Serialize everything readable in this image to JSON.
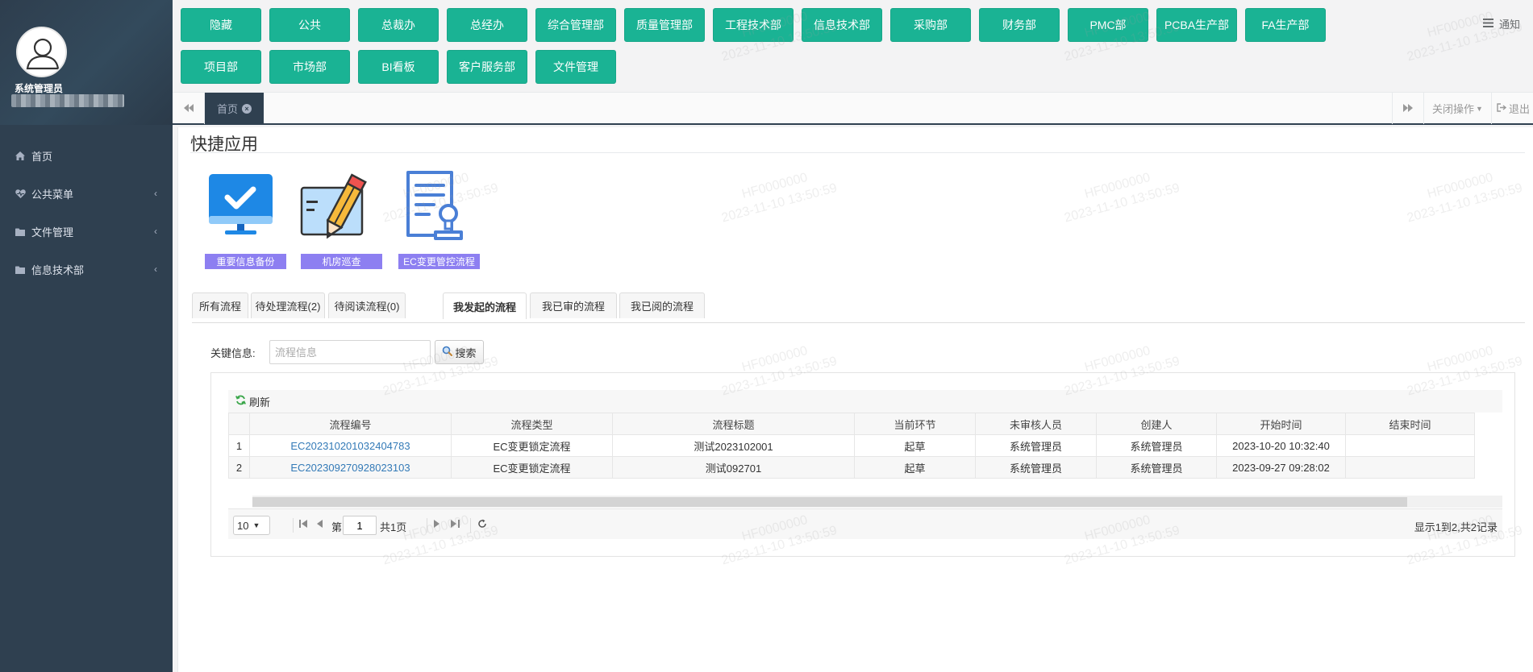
{
  "sidebar": {
    "user_role": "系统管理员",
    "user_name": "",
    "items": [
      {
        "label": "首页",
        "icon": "home-icon"
      },
      {
        "label": "公共菜单",
        "icon": "heartbeat-icon"
      },
      {
        "label": "文件管理",
        "icon": "folder-icon"
      },
      {
        "label": "信息技术部",
        "icon": "folder-icon"
      }
    ]
  },
  "departments": [
    "隐藏",
    "公共",
    "总裁办",
    "总经办",
    "综合管理部",
    "质量管理部",
    "工程技术部",
    "信息技术部",
    "采购部",
    "财务部",
    "PMC部",
    "PCBA生产部",
    "FA生产部",
    "项目部",
    "市场部",
    "BI看板",
    "客户服务部",
    "文件管理"
  ],
  "header": {
    "notice_label": "通知",
    "home_tab": "首页",
    "close_ops": "关闭操作",
    "logout": "退出"
  },
  "quick_apps": {
    "title": "快捷应用",
    "items": [
      {
        "label": "重要信息备份",
        "icon": "monitor-check-icon"
      },
      {
        "label": "机房巡查",
        "icon": "pencil-document-icon"
      },
      {
        "label": "EC变更管控流程",
        "icon": "document-stamp-icon"
      }
    ]
  },
  "flow_tabs": [
    {
      "label": "所有流程"
    },
    {
      "label": "待处理流程(2)"
    },
    {
      "label": "待阅读流程(0)"
    },
    {
      "label": "我发起的流程",
      "active": true
    },
    {
      "label": "我已审的流程"
    },
    {
      "label": "我已阅的流程"
    }
  ],
  "search": {
    "label": "关键信息:",
    "placeholder": "流程信息",
    "value": "",
    "button": "搜索"
  },
  "grid": {
    "refresh": "刷新",
    "columns": [
      "流程编号",
      "流程类型",
      "流程标题",
      "当前环节",
      "未审核人员",
      "创建人",
      "开始时间",
      "结束时间"
    ],
    "rows": [
      [
        "1",
        "EC202310201032404783",
        "EC变更锁定流程",
        "测试2023102001",
        "起草",
        "系统管理员",
        "系统管理员",
        "2023-10-20 10:32:40",
        ""
      ],
      [
        "2",
        "EC202309270928023103",
        "EC变更锁定流程",
        "测试092701",
        "起草",
        "系统管理员",
        "系统管理员",
        "2023-09-27 09:28:02",
        ""
      ]
    ]
  },
  "pager": {
    "page_size": "10",
    "page_prefix": "第",
    "page_value": "1",
    "page_total": "共1页",
    "info": "显示1到2,共2记录"
  },
  "watermark": {
    "id": "HF0000000",
    "time": "2023-11-10 13:50:59"
  },
  "colors": {
    "sidebar": "#2f4050",
    "accent_green": "#1ab394",
    "label_purple": "#8d7ff1",
    "link_blue": "#337ab7"
  }
}
